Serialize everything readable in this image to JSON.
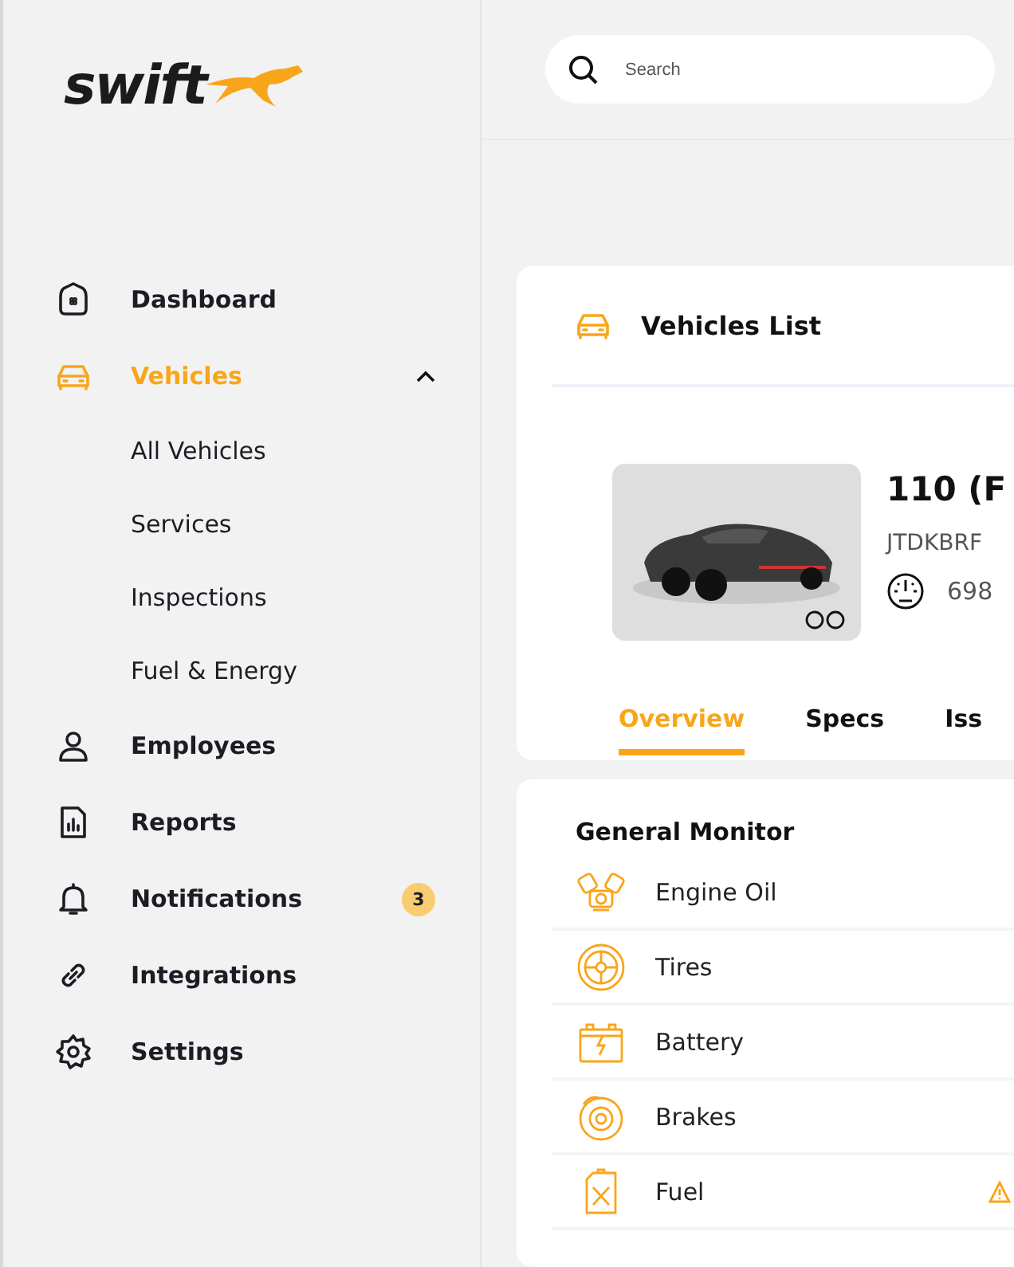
{
  "logo": {
    "text": "swift"
  },
  "sidebar": {
    "items": [
      {
        "label": "Dashboard",
        "selected": false
      },
      {
        "label": "Vehicles",
        "selected": true,
        "expanded": true,
        "children": [
          {
            "label": "All Vehicles"
          },
          {
            "label": "Services"
          },
          {
            "label": "Inspections"
          },
          {
            "label": "Fuel & Energy"
          }
        ]
      },
      {
        "label": "Employees",
        "selected": false
      },
      {
        "label": "Reports",
        "selected": false
      },
      {
        "label": "Notifications",
        "selected": false,
        "badge": "3"
      },
      {
        "label": "Integrations",
        "selected": false
      },
      {
        "label": "Settings",
        "selected": false
      }
    ]
  },
  "search": {
    "placeholder": "Search"
  },
  "vehicle_card": {
    "title": "Vehicles List",
    "name": "110 (F",
    "vin": "JTDKBRF",
    "odometer": "698",
    "tabs": [
      {
        "label": "Overview",
        "selected": true
      },
      {
        "label": "Specs",
        "selected": false
      },
      {
        "label": "Iss",
        "selected": false
      }
    ]
  },
  "monitor": {
    "title": "General Monitor",
    "rows": [
      {
        "label": "Engine Oil",
        "warning": false
      },
      {
        "label": "Tires",
        "warning": false
      },
      {
        "label": "Battery",
        "warning": false
      },
      {
        "label": "Brakes",
        "warning": false
      },
      {
        "label": "Fuel",
        "warning": true
      }
    ]
  }
}
